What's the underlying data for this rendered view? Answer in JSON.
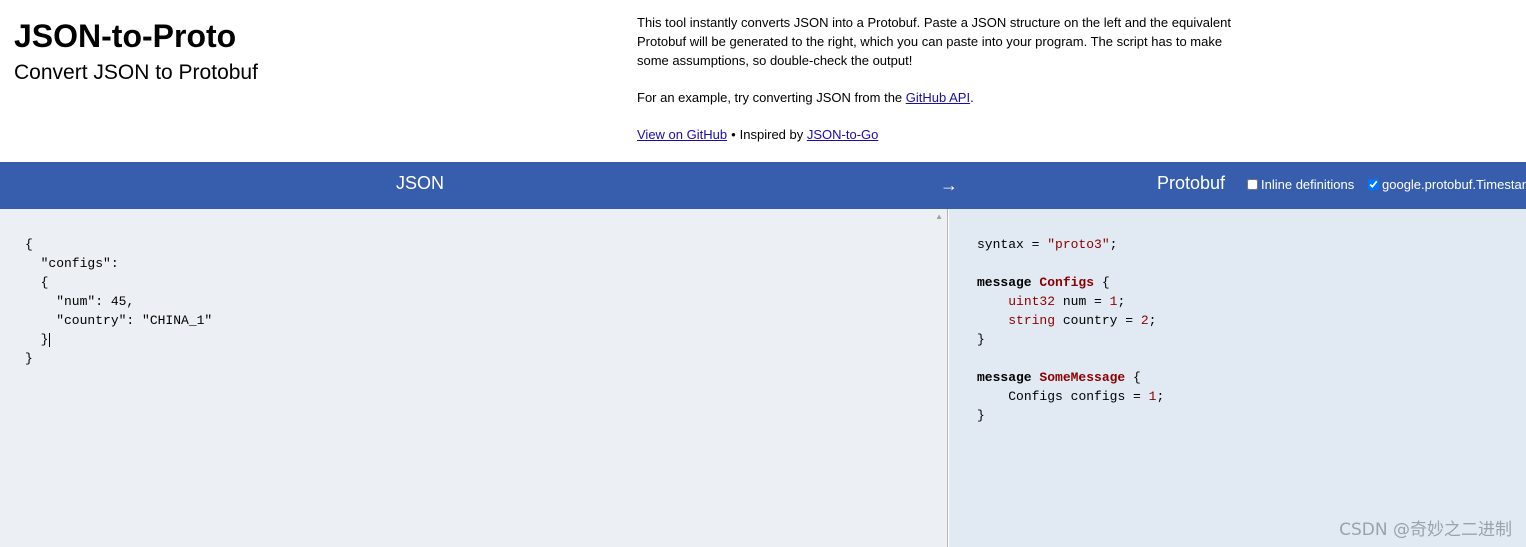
{
  "header": {
    "title": "JSON-to-Proto",
    "subtitle": "Convert JSON to Protobuf",
    "description": "This tool instantly converts JSON into a Protobuf. Paste a JSON structure on the left and the equivalent Protobuf will be generated to the right, which you can paste into your program. The script has to make some assumptions, so double-check the output!",
    "example_prefix": "For an example, try converting JSON from the ",
    "example_link": "GitHub API",
    "example_suffix": ".",
    "view_github": "View on GitHub",
    "bullet": "•",
    "inspired_prefix": "Inspired by ",
    "inspired_link": "JSON-to-Go"
  },
  "toolbar": {
    "json_label": "JSON",
    "arrow": "→",
    "protobuf_label": "Protobuf",
    "options": [
      {
        "label": "Inline definitions",
        "checked": false
      },
      {
        "label": "google.protobuf.Timestamp",
        "checked": true
      }
    ]
  },
  "json_input": {
    "lines": [
      "{",
      "  \"configs\":",
      "  {",
      "    \"num\": 45,",
      "    \"country\": \"CHINA_1\"",
      "  }",
      "}"
    ]
  },
  "proto_output": {
    "syntax_kw": "syntax",
    "syntax_eq": " = ",
    "syntax_val": "\"proto3\"",
    "semi": ";",
    "messages": [
      {
        "keyword": "message",
        "name": "Configs",
        "fields": [
          {
            "type": "uint32",
            "name": "num",
            "number": "1"
          },
          {
            "type": "string",
            "name": "country",
            "number": "2"
          }
        ]
      },
      {
        "keyword": "message",
        "name": "SomeMessage",
        "fields": [
          {
            "type": "Configs",
            "name": "configs",
            "number": "1"
          }
        ]
      }
    ]
  },
  "watermark": "CSDN @奇妙之二进制"
}
